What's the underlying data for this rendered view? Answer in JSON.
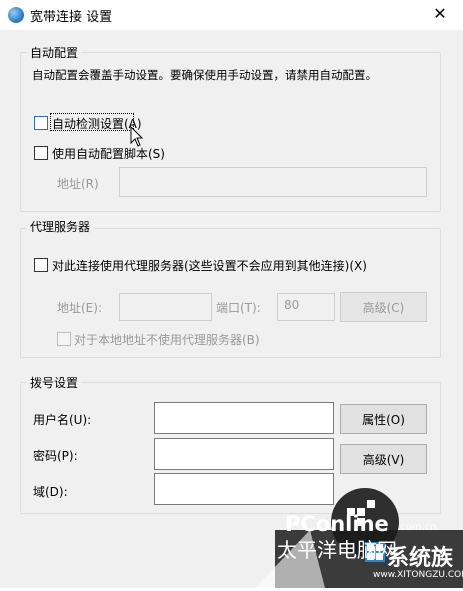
{
  "window": {
    "title": "宽带连接 设置",
    "close_glyph": "✕"
  },
  "auto_config": {
    "legend": "自动配置",
    "description": "自动配置会覆盖手动设置。要确保使用手动设置，请禁用自动配置。",
    "auto_detect_label": "自动检测设置(A)",
    "use_script_label": "使用自动配置脚本(S)",
    "address_label": "地址(R)",
    "address_value": ""
  },
  "proxy": {
    "legend": "代理服务器",
    "use_proxy_label": "对此连接使用代理服务器(这些设置不会应用到其他连接)(X)",
    "address_label": "地址(E):",
    "address_value": "",
    "port_label": "端口(T):",
    "port_value": "80",
    "advanced_label": "高级(C)",
    "bypass_local_label": "对于本地地址不使用代理服务器(B)"
  },
  "dialup": {
    "legend": "拨号设置",
    "username_label": "用户名(U):",
    "username_value": "",
    "password_label": "密码(P):",
    "password_value": "",
    "domain_label": "域(D):",
    "domain_value": "",
    "properties_label": "属性(O)",
    "advanced_label": "高级(V)"
  },
  "watermark": {
    "brand": "PConline",
    "domain": ".com.cn",
    "cn": "太平洋电脑网",
    "logo_text": "系统族",
    "site": "www.XITONGZU.COM"
  },
  "colors": {
    "dialog_bg": "#f0f0f0",
    "title_bg": "#ffffff",
    "focus_blue": "#2b6ad8"
  }
}
